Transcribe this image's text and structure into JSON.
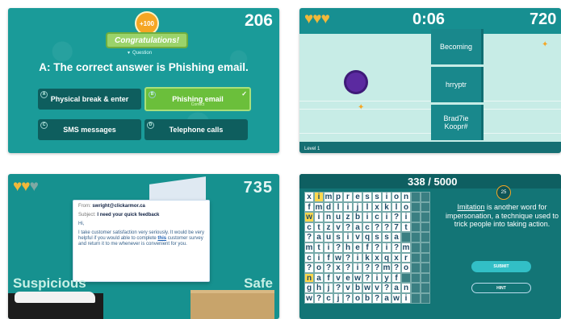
{
  "panel1": {
    "score": "206",
    "badge": "+100",
    "banner": "Congratulations!",
    "question_label": "Question",
    "answer": "A: The correct answer is Phishing email.",
    "options": [
      {
        "num": "A",
        "label": "Physical break & enter"
      },
      {
        "num": "B",
        "label": "Phishing email",
        "sub": "Correct"
      },
      {
        "num": "C",
        "label": "SMS messages"
      },
      {
        "num": "D",
        "label": "Telephone calls"
      }
    ]
  },
  "panel2": {
    "time": "0:06",
    "score": "720",
    "words": [
      "Becoming",
      "hrryptr",
      "Brad7ie Koopr#"
    ],
    "level": "Level 1",
    "hearts": 3
  },
  "panel3": {
    "score": "735",
    "hearts_full": 2,
    "hearts_total": 3,
    "email": {
      "from_label": "From:",
      "from": "swright@clickarmor.ca",
      "subject_label": "Subject:",
      "subject": "I need your quick feedback",
      "greeting": "Hi,",
      "body_pre": "I take customer satisfaction very seriously. It would be very helpful if you would able to complete ",
      "link": "this",
      "body_post": " customer survey and return it to me whenever is convenient for you."
    },
    "left_label": "Suspicious",
    "right_label": "Safe"
  },
  "panel4": {
    "score": "338 / 5000",
    "hint_count": "25",
    "clue_word": "Imitation",
    "clue_rest": " is another word for impersonation, a technique used to trick people into taking action.",
    "submit": "SUBMIT",
    "hint": "HINT",
    "grid": [
      "ximpression",
      "fmdlijlxklo",
      "winuzbici?i",
      "ctzv?ac??7t",
      "?ausivqssa",
      "mti?hef?i?m",
      "cifw?ikxqxr",
      "?o?x?i??m?o",
      "nafvew?iyf",
      "ghj?vbwv?an",
      "w?cj?ob?awi"
    ]
  },
  "colors": {
    "teal": "#1a9b99",
    "dark_teal": "#0e5e5e",
    "green": "#6bbf3b",
    "gold": "#f1b83a"
  }
}
